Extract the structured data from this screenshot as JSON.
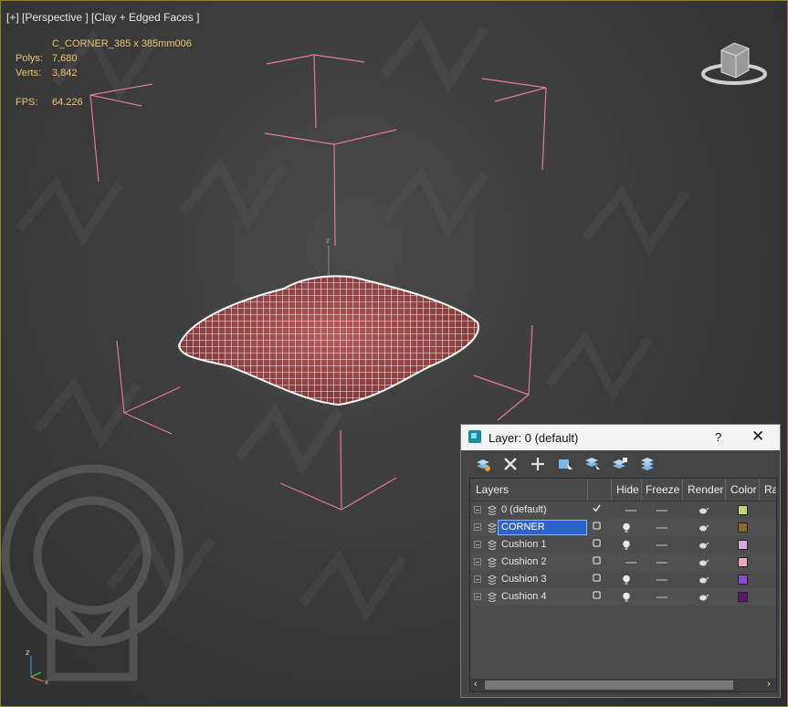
{
  "viewport": {
    "label": "[+] [Perspective ] [Clay + Edged Faces ]",
    "object_name": "C_CORNER_385 x 385mm006",
    "polys_label": "Polys:",
    "polys_value": "7,680",
    "verts_label": "Verts:",
    "verts_value": "3,842",
    "fps_label": "FPS:",
    "fps_value": "64.226"
  },
  "colors": {
    "stats_text": "#e8c86e",
    "bracket": "#e07aa0",
    "mesh": "#f4f0f0",
    "selection": "#2e63c9"
  },
  "dialog": {
    "title": "Layer: 0 (default)",
    "help": "?",
    "close": "✕",
    "toolbar_icons": [
      "create-layer-icon",
      "delete-icon",
      "add-icon",
      "select-objects-icon",
      "select-layers-icon",
      "highlight-icon",
      "hierarchy-icon"
    ],
    "columns": [
      "Layers",
      "Hide",
      "Freeze",
      "Render",
      "Color",
      "Ra"
    ],
    "rows": [
      {
        "name": "0 (default)",
        "active": true,
        "hidden": true,
        "color": "#c7d66a"
      },
      {
        "name": "CORNER",
        "active": false,
        "hidden": false,
        "color": "#8a6a2a",
        "selected": true
      },
      {
        "name": "Cushion 1",
        "active": false,
        "hidden": false,
        "color": "#d8a8e0"
      },
      {
        "name": "Cushion 2",
        "active": false,
        "hidden": true,
        "color": "#e8a8b8"
      },
      {
        "name": "Cushion 3",
        "active": false,
        "hidden": false,
        "color": "#8a4ad6"
      },
      {
        "name": "Cushion 4",
        "active": false,
        "hidden": false,
        "color": "#5a1a6a"
      }
    ]
  }
}
